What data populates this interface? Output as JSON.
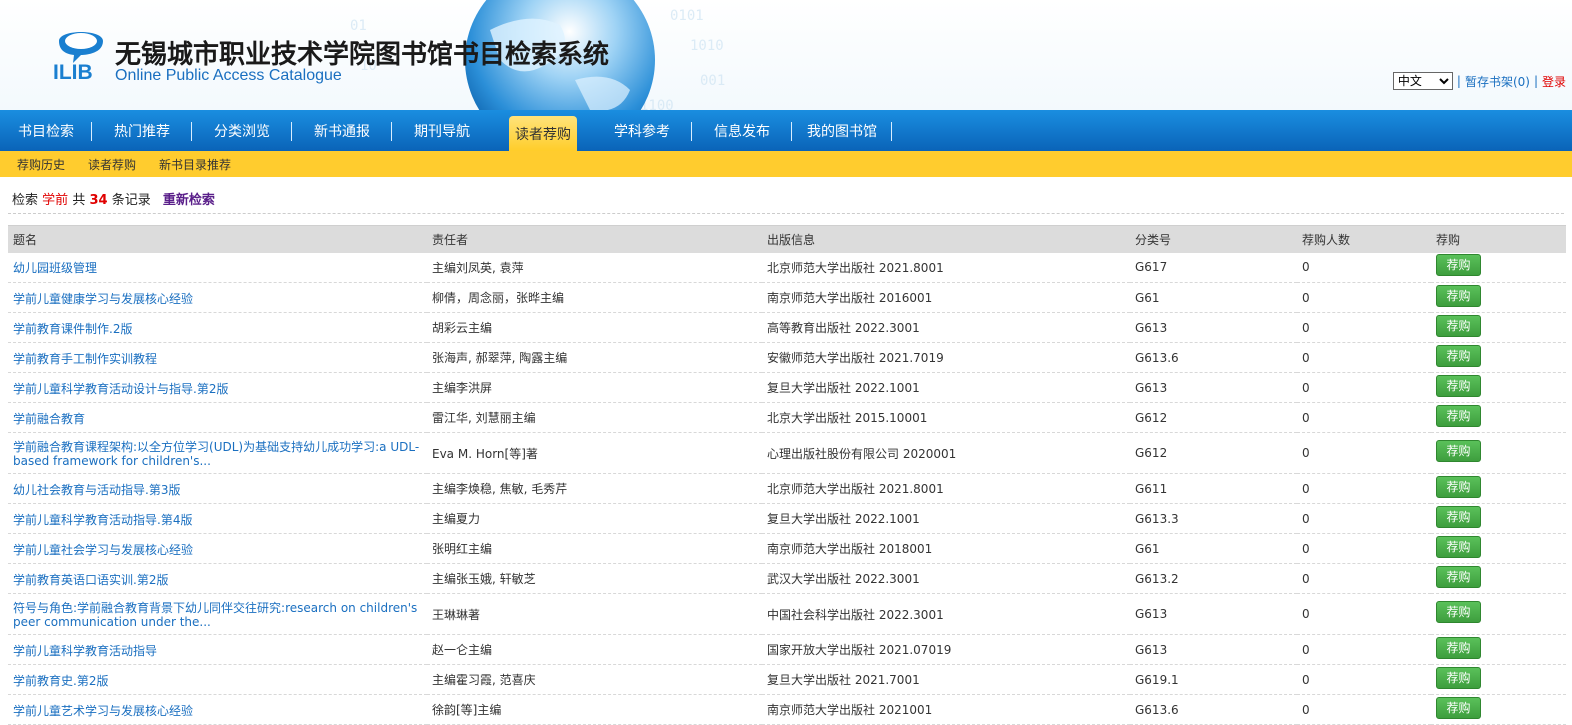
{
  "header": {
    "logo_text": "ILIB",
    "title": "无锡城市职业技术学院图书馆书目检索系统",
    "subtitle": "Online Public Access Catalogue",
    "language": "中文",
    "shelf_link": "暂存书架(0)",
    "login_link": "登录",
    "separator": "|"
  },
  "main_nav": [
    {
      "label": "书目检索",
      "width": 92,
      "active": false
    },
    {
      "label": "热门推荐",
      "width": 100,
      "active": false
    },
    {
      "label": "分类浏览",
      "width": 100,
      "active": false
    },
    {
      "label": "新书通报",
      "width": 100,
      "active": false
    },
    {
      "label": "期刊导航",
      "width": 100,
      "active": false
    },
    {
      "label": "读者荐购",
      "width": 68,
      "active": true
    },
    {
      "label": "学科参考",
      "width": 100,
      "active": false
    },
    {
      "label": "信息发布",
      "width": 100,
      "active": false
    },
    {
      "label": "我的图书馆",
      "width": 100,
      "active": false
    }
  ],
  "sub_nav": [
    "荐购历史",
    "读者荐购",
    "新书目录推荐"
  ],
  "search_summary": {
    "prefix": "检索",
    "keyword": "学前",
    "middle": "共",
    "count": "34",
    "suffix": "条记录",
    "research_link": "重新检索"
  },
  "table": {
    "columns": [
      "题名",
      "责任者",
      "出版信息",
      "分类号",
      "荐购人数",
      "荐购"
    ],
    "button_label": "荐购",
    "rows": [
      {
        "title": "幼儿园班级管理",
        "author": "主编刘凤英, 袁萍",
        "publisher": "北京师范大学出版社 2021.8001",
        "class": "G617",
        "count": "0"
      },
      {
        "title": "学前儿童健康学习与发展核心经验",
        "author": "柳倩，周念丽，张晔主编",
        "publisher": "南京师范大学出版社 2016001",
        "class": "G61",
        "count": "0"
      },
      {
        "title": "学前教育课件制作.2版",
        "author": "胡彩云主编",
        "publisher": "高等教育出版社 2022.3001",
        "class": "G613",
        "count": "0"
      },
      {
        "title": "学前教育手工制作实训教程",
        "author": "张海声, 郝翠萍, 陶露主编",
        "publisher": "安徽师范大学出版社 2021.7019",
        "class": "G613.6",
        "count": "0"
      },
      {
        "title": "学前儿童科学教育活动设计与指导.第2版",
        "author": "主编李洪屏",
        "publisher": "复旦大学出版社 2022.1001",
        "class": "G613",
        "count": "0"
      },
      {
        "title": "学前融合教育",
        "author": "雷江华, 刘慧丽主编",
        "publisher": "北京大学出版社 2015.10001",
        "class": "G612",
        "count": "0"
      },
      {
        "title": "学前融合教育课程架构:以全方位学习(UDL)为基础支持幼儿成功学习:a UDL-based framework for children's...",
        "author": "Eva M. Horn[等]著",
        "publisher": "心理出版社股份有限公司 2020001",
        "class": "G612",
        "count": "0",
        "double": true
      },
      {
        "title": "幼儿社会教育与活动指导.第3版",
        "author": "主编李焕稳, 焦敏, 毛秀芹",
        "publisher": "北京师范大学出版社 2021.8001",
        "class": "G611",
        "count": "0"
      },
      {
        "title": "学前儿童科学教育活动指导.第4版",
        "author": "主编夏力",
        "publisher": "复旦大学出版社 2022.1001",
        "class": "G613.3",
        "count": "0"
      },
      {
        "title": "学前儿童社会学习与发展核心经验",
        "author": "张明红主编",
        "publisher": "南京师范大学出版社 2018001",
        "class": "G61",
        "count": "0"
      },
      {
        "title": "学前教育英语口语实训.第2版",
        "author": "主编张玉娥, 轩敏芝",
        "publisher": "武汉大学出版社 2022.3001",
        "class": "G613.2",
        "count": "0"
      },
      {
        "title": "符号与角色:学前融合教育背景下幼儿同伴交往研究:research on children's peer communication under the...",
        "author": "王琳琳著",
        "publisher": "中国社会科学出版社 2022.3001",
        "class": "G613",
        "count": "0",
        "double": true
      },
      {
        "title": "学前儿童科学教育活动指导",
        "author": "赵一仑主编",
        "publisher": "国家开放大学出版社 2021.07019",
        "class": "G613",
        "count": "0"
      },
      {
        "title": "学前教育史.第2版",
        "author": "主编霍习霞, 范喜庆",
        "publisher": "复旦大学出版社 2021.7001",
        "class": "G619.1",
        "count": "0"
      },
      {
        "title": "学前儿童艺术学习与发展核心经验",
        "author": "徐韵[等]主编",
        "publisher": "南京师范大学出版社 2021001",
        "class": "G613.6",
        "count": "0"
      }
    ]
  }
}
